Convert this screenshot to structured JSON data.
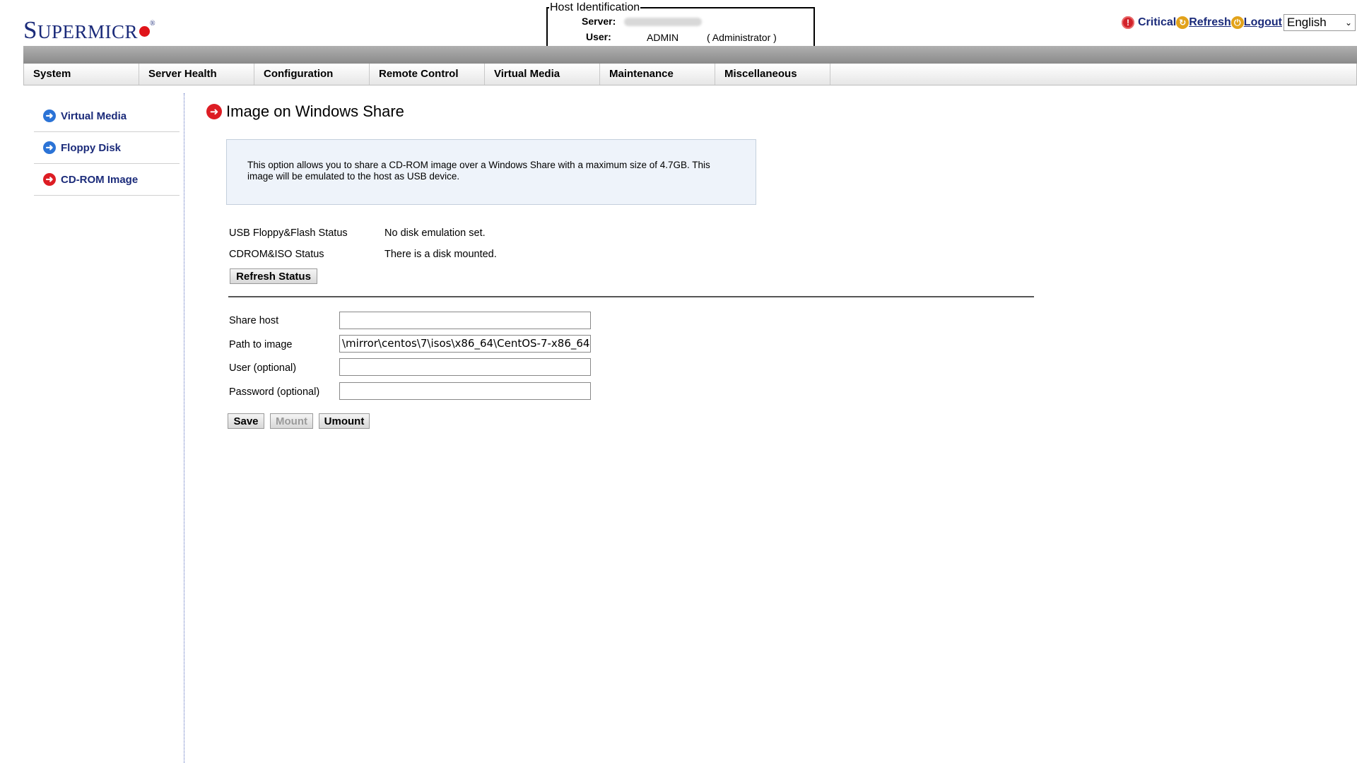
{
  "brand": {
    "first": "S",
    "rest": "UPERMICR",
    "reg": "®"
  },
  "host": {
    "legend": "Host Identification",
    "server_label": "Server:",
    "user_label": "User:",
    "user_value": "ADMIN",
    "role": "( Administrator )"
  },
  "top_actions": {
    "critical": "Critical",
    "refresh": "Refresh",
    "logout": "Logout",
    "language": "English"
  },
  "menu": [
    "System",
    "Server Health",
    "Configuration",
    "Remote Control",
    "Virtual Media",
    "Maintenance",
    "Miscellaneous"
  ],
  "sidebar": {
    "items": [
      {
        "label": "Virtual Media",
        "icon": "arrow-right-blue-icon"
      },
      {
        "label": "Floppy Disk",
        "icon": "arrow-right-blue-icon"
      },
      {
        "label": "CD-ROM Image",
        "icon": "arrow-right-red-icon"
      }
    ]
  },
  "page": {
    "title": "Image on Windows Share",
    "info": "This option allows you to share a CD-ROM image over a Windows Share with a maximum size of 4.7GB. This image will be emulated to the host as USB device.",
    "usb_label": "USB Floppy&Flash Status",
    "usb_value": "No disk emulation set.",
    "cdrom_label": "CDROM&ISO Status",
    "cdrom_value": "There is a disk mounted.",
    "refresh_status": "Refresh Status",
    "form": {
      "share_host_label": "Share host",
      "share_host_value": "",
      "path_label": "Path to image",
      "path_value": "\\mirror\\centos\\7\\isos\\x86_64\\CentOS-7-x86_64",
      "user_label": "User (optional)",
      "user_value": "",
      "password_label": "Password (optional)",
      "password_value": ""
    },
    "buttons": {
      "save": "Save",
      "mount": "Mount",
      "umount": "Umount"
    }
  },
  "colors": {
    "brand": "#1b2b7a",
    "accent_red": "#dd1d24",
    "link_blue": "#1b2b7a"
  }
}
